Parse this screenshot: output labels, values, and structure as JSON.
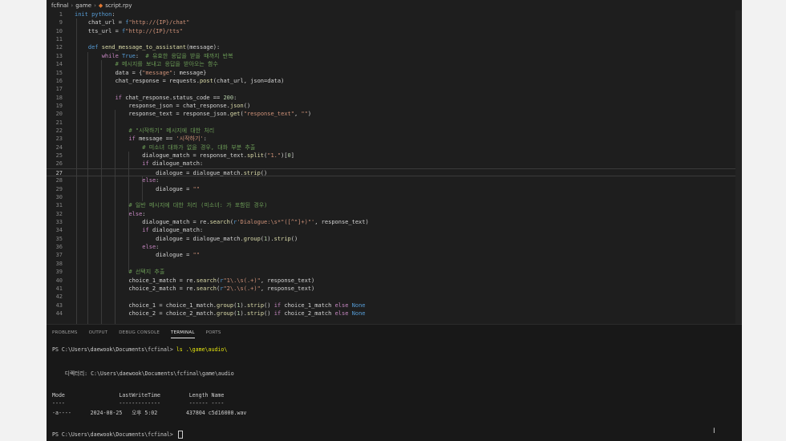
{
  "breadcrumb": {
    "items": [
      "fcfinal",
      "game",
      "script.rpy"
    ]
  },
  "editor": {
    "current_line": "27",
    "lines": [
      {
        "n": "1",
        "html": "<span class=\"kw\">init</span> <span class=\"kw\">python</span>:"
      },
      {
        "n": "9",
        "html": "    chat_url = <span class=\"kw\">f</span><span class=\"str\">\"http://{IP}/chat\"</span>"
      },
      {
        "n": "10",
        "html": "    tts_url = <span class=\"kw\">f</span><span class=\"str\">\"http://{IP}/tts\"</span>"
      },
      {
        "n": "11",
        "html": ""
      },
      {
        "n": "12",
        "html": "    <span class=\"kw\">def</span> <span class=\"fn\">send_message_to_assistant</span>(message):"
      },
      {
        "n": "13",
        "html": "        <span class=\"ctl\">while</span> <span class=\"kw\">True</span>:  <span class=\"cm\"># 유효한 응답을 받을 때까지 반복</span>"
      },
      {
        "n": "14",
        "html": "            <span class=\"cm\"># 메시지를 보내고 응답을 받아오는 함수</span>"
      },
      {
        "n": "15",
        "html": "            data = {<span class=\"str\">\"message\"</span>: message}"
      },
      {
        "n": "16",
        "html": "            chat_response = requests.<span class=\"fn\">post</span>(chat_url, json=data)"
      },
      {
        "n": "17",
        "html": ""
      },
      {
        "n": "18",
        "html": "            <span class=\"ctl\">if</span> chat_response.status_code == <span class=\"num\">200</span>:"
      },
      {
        "n": "19",
        "html": "                response_json = chat_response.<span class=\"fn\">json</span>()"
      },
      {
        "n": "20",
        "html": "                response_text = response_json.<span class=\"fn\">get</span>(<span class=\"str\">\"response_text\"</span>, <span class=\"str\">\"\"</span>)"
      },
      {
        "n": "21",
        "html": ""
      },
      {
        "n": "22",
        "html": "                <span class=\"cm\"># \"시작하기\" 메시지에 대한 처리</span>"
      },
      {
        "n": "23",
        "html": "                <span class=\"ctl\">if</span> message == <span class=\"str\">'시작하기'</span>:"
      },
      {
        "n": "24",
        "html": "                    <span class=\"cm\"># 미소녀 대화가 없을 경우, 대화 부분 추출</span>"
      },
      {
        "n": "25",
        "html": "                    dialogue_match = response_text.<span class=\"fn\">split</span>(<span class=\"str\">\"1.\"</span>)[<span class=\"num\">0</span>]"
      },
      {
        "n": "26",
        "html": "                    <span class=\"ctl\">if</span> dialogue_match:"
      },
      {
        "n": "27",
        "html": "                        dialogue = dialogue_match.<span class=\"fn\">strip</span>()"
      },
      {
        "n": "28",
        "html": "                    <span class=\"ctl\">else</span>:"
      },
      {
        "n": "29",
        "html": "                        dialogue = <span class=\"str\">\"\"</span>"
      },
      {
        "n": "30",
        "html": ""
      },
      {
        "n": "31",
        "html": "                <span class=\"cm\"># 일반 메시지에 대한 처리 (미소녀: 가 포함된 경우)</span>"
      },
      {
        "n": "32",
        "html": "                <span class=\"ctl\">else</span>:"
      },
      {
        "n": "33",
        "html": "                    dialogue_match = re.<span class=\"fn\">search</span>(<span class=\"kw\">r</span><span class=\"str\">'Dialogue:\\s*\"([^\"]+)\"'</span>, response_text)"
      },
      {
        "n": "34",
        "html": "                    <span class=\"ctl\">if</span> dialogue_match:"
      },
      {
        "n": "35",
        "html": "                        dialogue = dialogue_match.<span class=\"fn\">group</span>(<span class=\"num\">1</span>).<span class=\"fn\">strip</span>()"
      },
      {
        "n": "36",
        "html": "                    <span class=\"ctl\">else</span>:"
      },
      {
        "n": "37",
        "html": "                        dialogue = <span class=\"str\">\"\"</span>"
      },
      {
        "n": "38",
        "html": ""
      },
      {
        "n": "39",
        "html": "                <span class=\"cm\"># 선택지 추출</span>"
      },
      {
        "n": "40",
        "html": "                choice_1_match = re.<span class=\"fn\">search</span>(<span class=\"kw\">r</span><span class=\"str\">\"1\\.\\s(.+)\"</span>, response_text)"
      },
      {
        "n": "41",
        "html": "                choice_2_match = re.<span class=\"fn\">search</span>(<span class=\"kw\">r</span><span class=\"str\">\"2\\.\\s(.+)\"</span>, response_text)"
      },
      {
        "n": "42",
        "html": ""
      },
      {
        "n": "43",
        "html": "                choice_1 = choice_1_match.<span class=\"fn\">group</span>(<span class=\"num\">1</span>).<span class=\"fn\">strip</span>() <span class=\"ctl\">if</span> choice_1_match <span class=\"ctl\">else</span> <span class=\"kw\">None</span>"
      },
      {
        "n": "44",
        "html": "                choice_2 = choice_2_match.<span class=\"fn\">group</span>(<span class=\"num\">1</span>).<span class=\"fn\">strip</span>() <span class=\"ctl\">if</span> choice_2_match <span class=\"ctl\">else</span> <span class=\"kw\">None</span>"
      }
    ]
  },
  "panel": {
    "tabs": [
      "PROBLEMS",
      "OUTPUT",
      "DEBUG CONSOLE",
      "TERMINAL",
      "PORTS"
    ],
    "active_tab": "TERMINAL"
  },
  "terminal": {
    "prompt1": "PS C:\\Users\\daewook\\Documents\\fcfinal> ",
    "cmd1": "ls .\\game\\audio\\",
    "dir_line": "    디렉터리: C:\\Users\\daewook\\Documents\\fcfinal\\game\\audio",
    "header": "Mode                 LastWriteTime         Length Name",
    "underline": "----                 -------------         ------ ----",
    "row": "-a----      2024-08-25   오후 5:02         437804 c5d16000.wav",
    "prompt2": "PS C:\\Users\\daewook\\Documents\\fcfinal> "
  },
  "colors": {
    "editor_bg": "#1e1e1e",
    "panel_bg": "#181818",
    "frame_bg": "#f2f2f2"
  }
}
